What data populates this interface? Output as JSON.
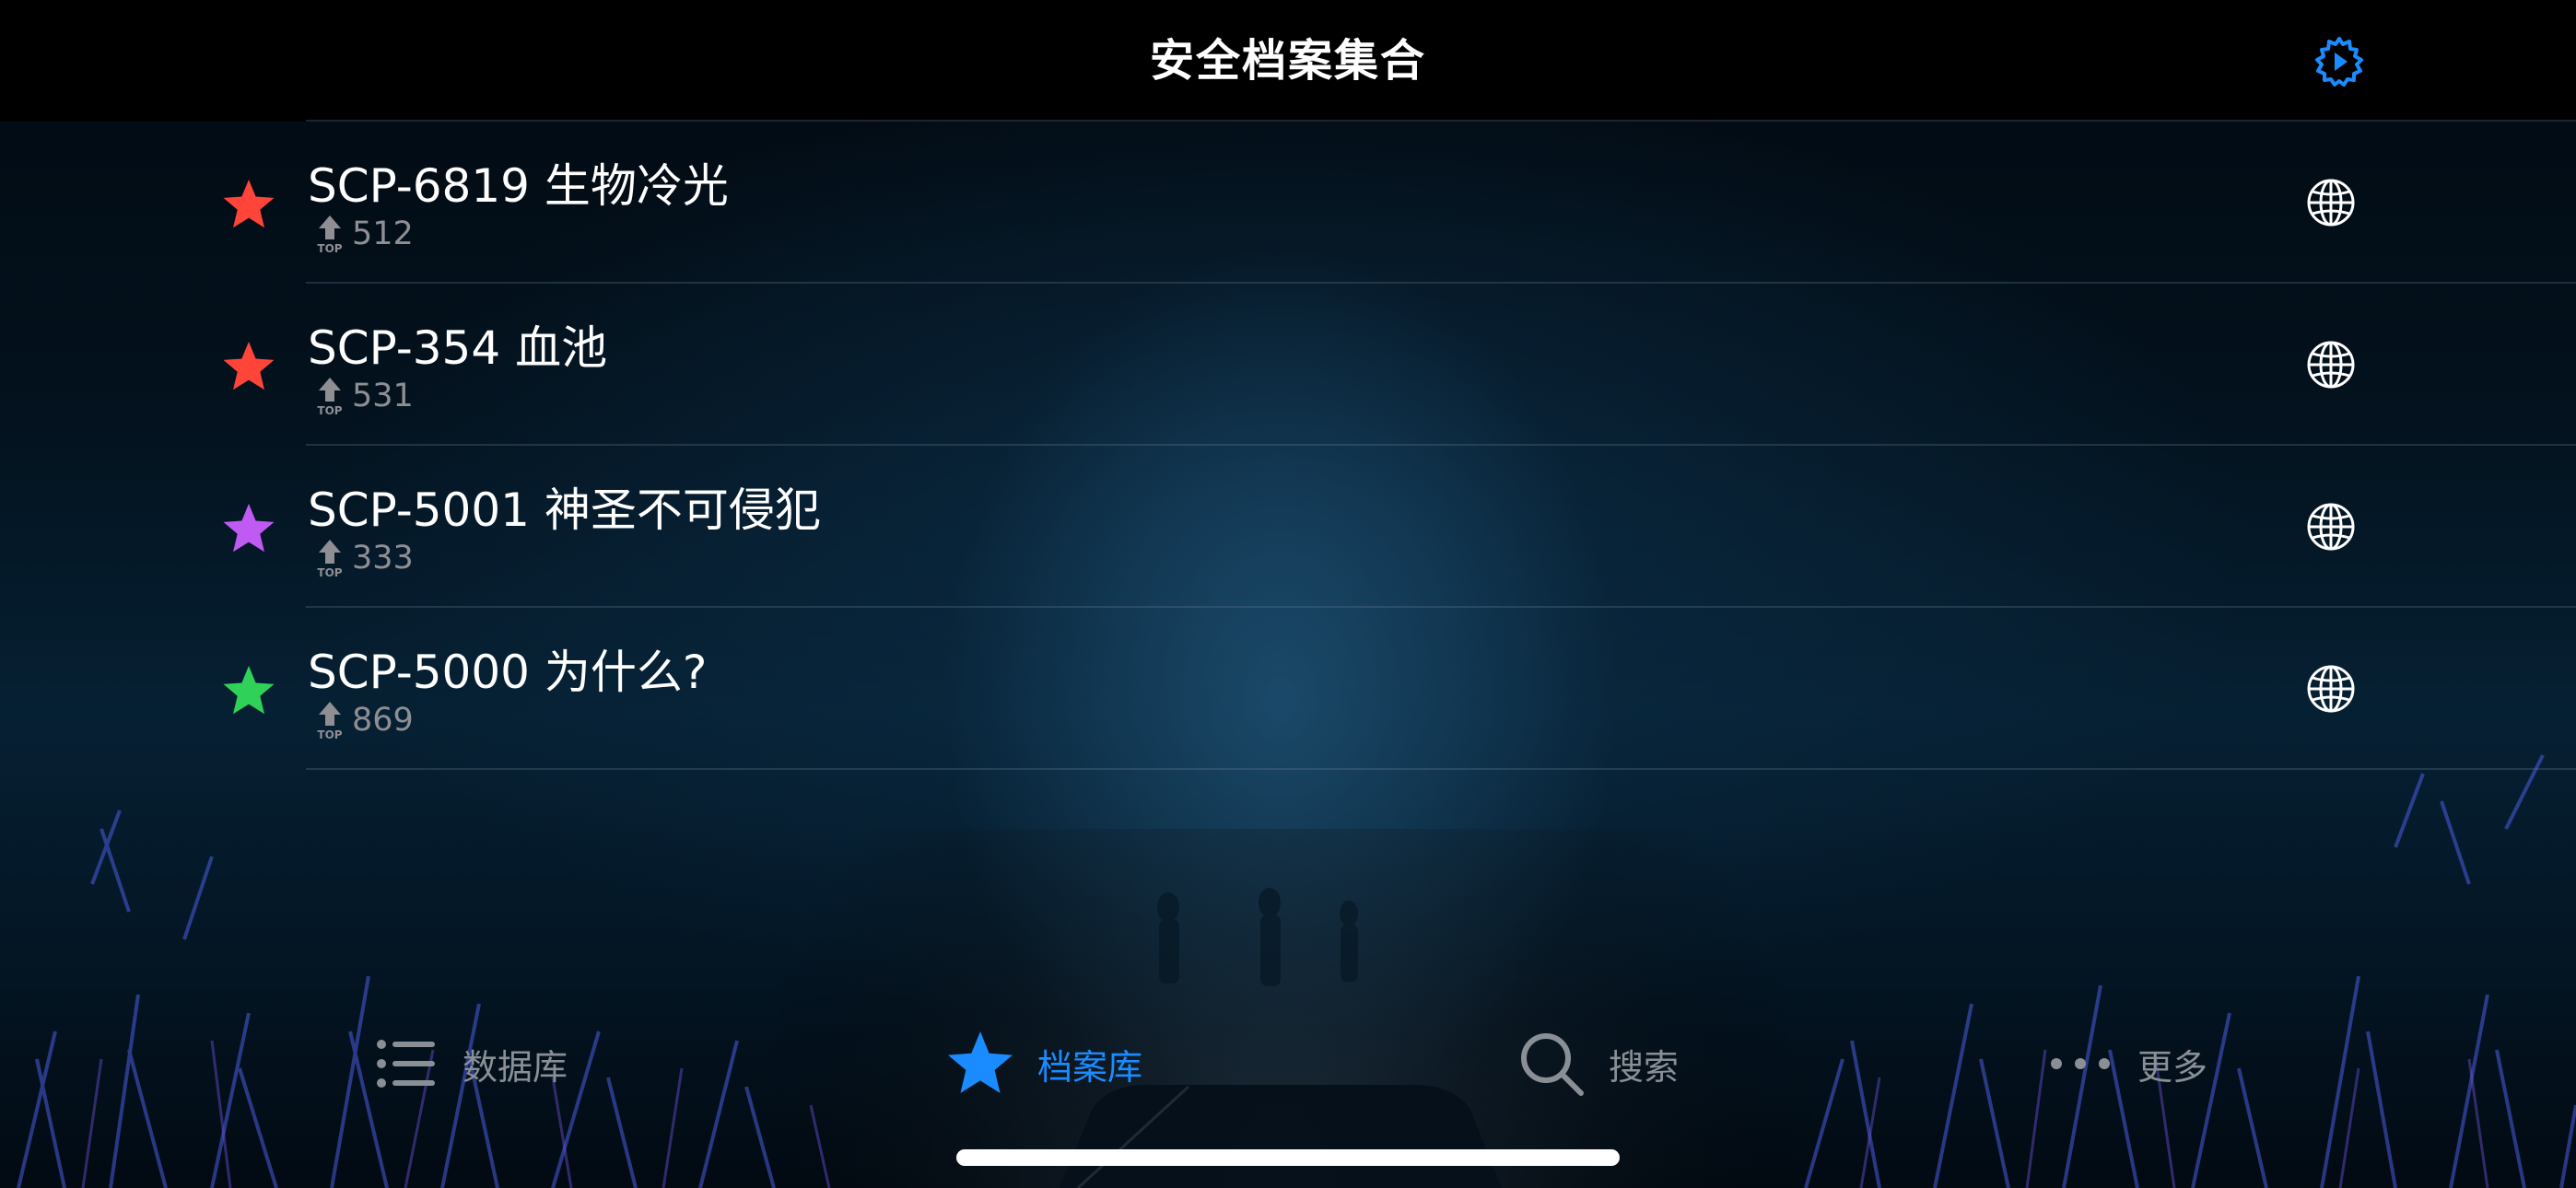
{
  "header": {
    "title": "安全档案集合",
    "settings_icon": "gear-play-icon"
  },
  "colors": {
    "accent": "#1a8cff",
    "star_red": "#ff453a",
    "star_purple": "#bf5af2",
    "star_green": "#30d158",
    "secondary_text": "#8e8e93"
  },
  "list": {
    "items": [
      {
        "title": "SCP-6819 生物冷光",
        "count": "512",
        "star_color": "#ff453a",
        "action_icon": "globe-icon"
      },
      {
        "title": "SCP-354 血池",
        "count": "531",
        "star_color": "#ff453a",
        "action_icon": "globe-icon"
      },
      {
        "title": "SCP-5001 神圣不可侵犯",
        "count": "333",
        "star_color": "#bf5af2",
        "action_icon": "globe-icon"
      },
      {
        "title": "SCP-5000 为什么?",
        "count": "869",
        "star_color": "#30d158",
        "action_icon": "globe-icon"
      }
    ]
  },
  "tabbar": {
    "tabs": [
      {
        "label": "数据库",
        "icon": "list-icon",
        "active": false
      },
      {
        "label": "档案库",
        "icon": "star-icon",
        "active": true
      },
      {
        "label": "搜索",
        "icon": "search-icon",
        "active": false
      },
      {
        "label": "更多",
        "icon": "more-icon",
        "active": false
      }
    ]
  }
}
